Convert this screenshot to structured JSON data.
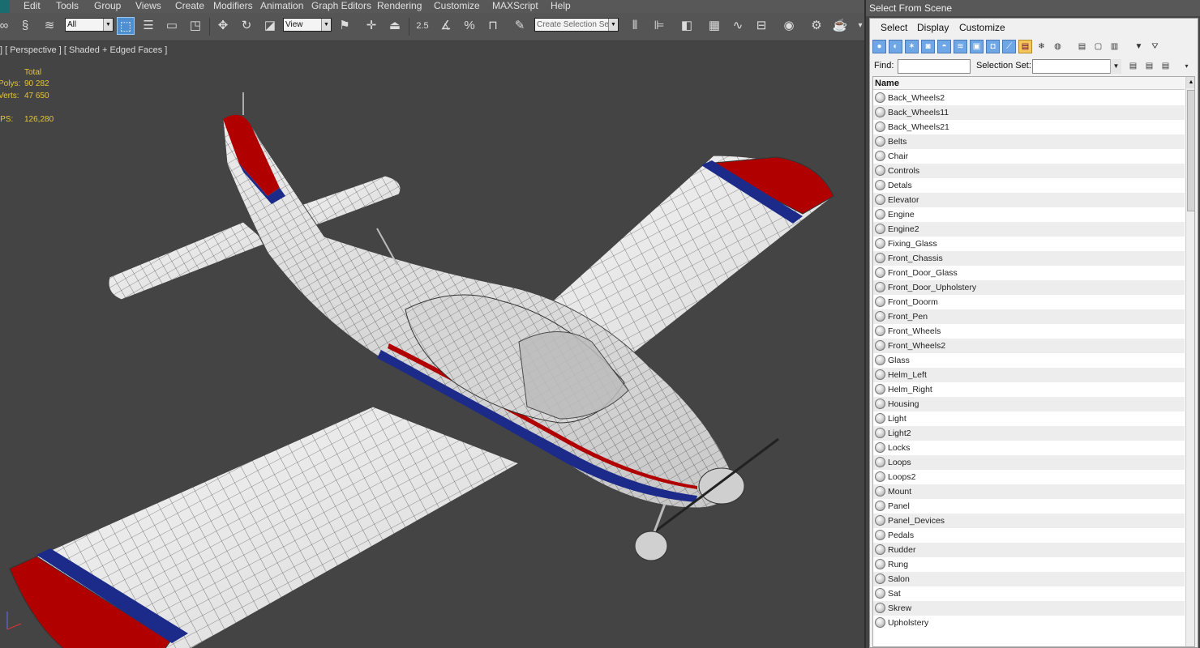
{
  "menubar": {
    "items": [
      "Edit",
      "Tools",
      "Group",
      "Views",
      "Create",
      "Modifiers",
      "Animation",
      "Graph Editors",
      "Rendering",
      "Customize",
      "MAXScript",
      "Help"
    ]
  },
  "toolbar": {
    "filter_value": "All",
    "refcoord_value": "View",
    "snap_label": "2.5",
    "named_selection_placeholder": "Create Selection Se"
  },
  "viewport": {
    "label": "] [ Perspective ] [ Shaded + Edged Faces ]",
    "stats_header": "Total",
    "polys_label": "Polys:",
    "polys_value": "90 282",
    "verts_label": "Verts:",
    "verts_value": "47 650",
    "fps_label": "FPS:",
    "fps_value": "126,280",
    "stat_color": "#e5c635"
  },
  "panel": {
    "title": "Select From Scene",
    "menu": [
      "Select",
      "Display",
      "Customize"
    ],
    "find_label": "Find:",
    "find_value": "",
    "selset_label": "Selection Set:",
    "selset_value": "",
    "column_header": "Name",
    "objects": [
      "Back_Wheels2",
      "Back_Wheels11",
      "Back_Wheels21",
      "Belts",
      "Chair",
      "Controls",
      "Detals",
      "Elevator",
      "Engine",
      "Engine2",
      "Fixing_Glass",
      "Front_Chassis",
      "Front_Door_Glass",
      "Front_Door_Upholstery",
      "Front_Doorm",
      "Front_Pen",
      "Front_Wheels",
      "Front_Wheels2",
      "Glass",
      "Helm_Left",
      "Helm_Right",
      "Housing",
      "Light",
      "Light2",
      "Locks",
      "Loops",
      "Loops2",
      "Mount",
      "Panel",
      "Panel_Devices",
      "Pedals",
      "Rudder",
      "Rung",
      "Salon",
      "Sat",
      "Skrew",
      "Upholstery"
    ]
  },
  "colors": {
    "accent_active": "#4d8fd1",
    "plane_red": "#b00000",
    "plane_blue": "#1c2b8a"
  }
}
